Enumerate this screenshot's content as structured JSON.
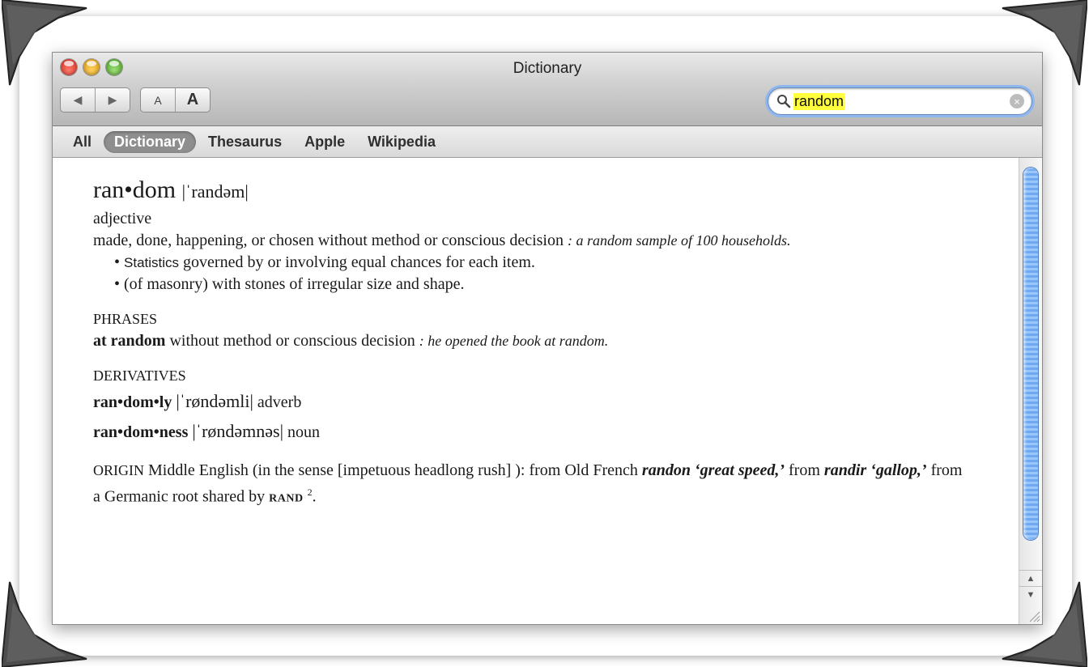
{
  "window": {
    "title": "Dictionary",
    "traffic_lights": {
      "close": "#e0473a",
      "minimize": "#f0b42c",
      "zoom": "#69c245"
    }
  },
  "toolbar": {
    "back_icon": "back-arrow-icon",
    "forward_icon": "forward-arrow-icon",
    "font_small_label": "A",
    "font_large_label": "A"
  },
  "search": {
    "value": "random",
    "highlight_color": "#ffff3c"
  },
  "tabs": [
    {
      "label": "All"
    },
    {
      "label": "Dictionary",
      "active": true
    },
    {
      "label": "Thesaurus"
    },
    {
      "label": "Apple"
    },
    {
      "label": "Wikipedia"
    }
  ],
  "entry": {
    "headword": "ran•dom",
    "pronunciation": "|ˈrandəm|",
    "pos": "adjective",
    "definition": "made, done, happening, or chosen without method or conscious decision",
    "example": ": a random sample of 100 households.",
    "sense2_label": "Statistics",
    "sense2_text": "governed by or involving equal chances for each item.",
    "sense3_text": "(of masonry) with stones of irregular size and shape.",
    "phrases_heading": "PHRASES",
    "phrase_term": "at random",
    "phrase_def": "without method or conscious decision",
    "phrase_example": ": he opened the book at random.",
    "derivatives_heading": "DERIVATIVES",
    "deriv1_term": "ran•dom•ly",
    "deriv1_pron": "|ˈrøndəmli|",
    "deriv1_pos": "adverb",
    "deriv2_term": "ran•dom•ness",
    "deriv2_pron": "|ˈrøndəmnəs|",
    "deriv2_pos": "noun",
    "origin_label": "ORIGIN",
    "origin_text1": "Middle English (in the sense [impetuous headlong rush] ): from Old French",
    "origin_term1": "randon ‘great speed,’",
    "origin_text2": "from",
    "origin_term2": "randir ‘gallop,’",
    "origin_text3": "from a Germanic root shared by",
    "origin_xref": "RAND",
    "origin_sup": "2",
    "origin_end": "."
  },
  "scrollbar": {
    "up_icon": "scroll-up-arrow-icon",
    "down_icon": "scroll-down-arrow-icon"
  }
}
